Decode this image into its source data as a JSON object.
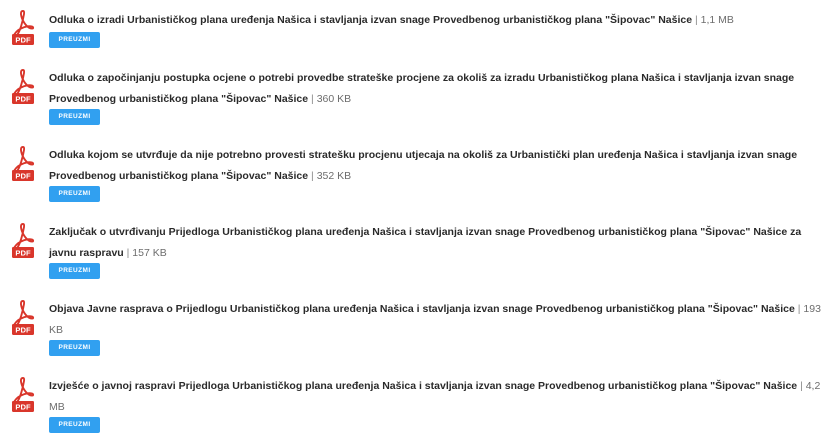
{
  "icons": {
    "file": "pdf-file-icon"
  },
  "colors": {
    "button": "#31a0f0",
    "pdf_red": "#d9362b"
  },
  "documents": [
    {
      "title": "Odluka o izradi Urbanističkog plana uređenja Našica i stavljanja izvan snage Provedbenog urbanističkog plana \"Šipovac\" Našice",
      "separator": "|",
      "size": "1,1 MB",
      "icon_label": "PDF",
      "button_label": "PREUZMI"
    },
    {
      "title": "Odluka o započinjanju postupka ocjene o potrebi provedbe strateške procjene za okoliš za izradu Urbanističkog plana Našica i stavljanja izvan snage Provedbenog urbanističkog plana \"Šipovac\" Našice",
      "separator": "|",
      "size": "360 KB",
      "icon_label": "PDF",
      "button_label": "PREUZMI"
    },
    {
      "title": "Odluka kojom se utvrđuje da nije potrebno provesti stratešku procjenu utjecaja na okoliš za Urbanistički plan uređenja Našica i stavljanja izvan snage Provedbenog urbanističkog plana \"Šipovac\" Našice",
      "separator": "|",
      "size": "352 KB",
      "icon_label": "PDF",
      "button_label": "PREUZMI"
    },
    {
      "title": "Zaključak o utvrđivanju Prijedloga Urbanističkog plana uređenja Našica i stavljanja izvan snage Provedbenog urbanističkog plana \"Šipovac\" Našice za javnu raspravu",
      "separator": "|",
      "size": "157 KB",
      "icon_label": "PDF",
      "button_label": "PREUZMI"
    },
    {
      "title": "Objava Javne rasprava o Prijedlogu Urbanističkog plana uređenja Našica i stavljanja izvan snage Provedbenog urbanističkog plana \"Šipovac\" Našice",
      "separator": "|",
      "size": "193 KB",
      "icon_label": "PDF",
      "button_label": "PREUZMI"
    },
    {
      "title": "Izvješće o javnoj raspravi Prijedloga Urbanističkog plana uređenja Našica i stavljanja izvan snage Provedbenog urbanističkog plana \"Šipovac\" Našice",
      "separator": "|",
      "size": "4,2 MB",
      "icon_label": "PDF",
      "button_label": "PREUZMI"
    }
  ]
}
